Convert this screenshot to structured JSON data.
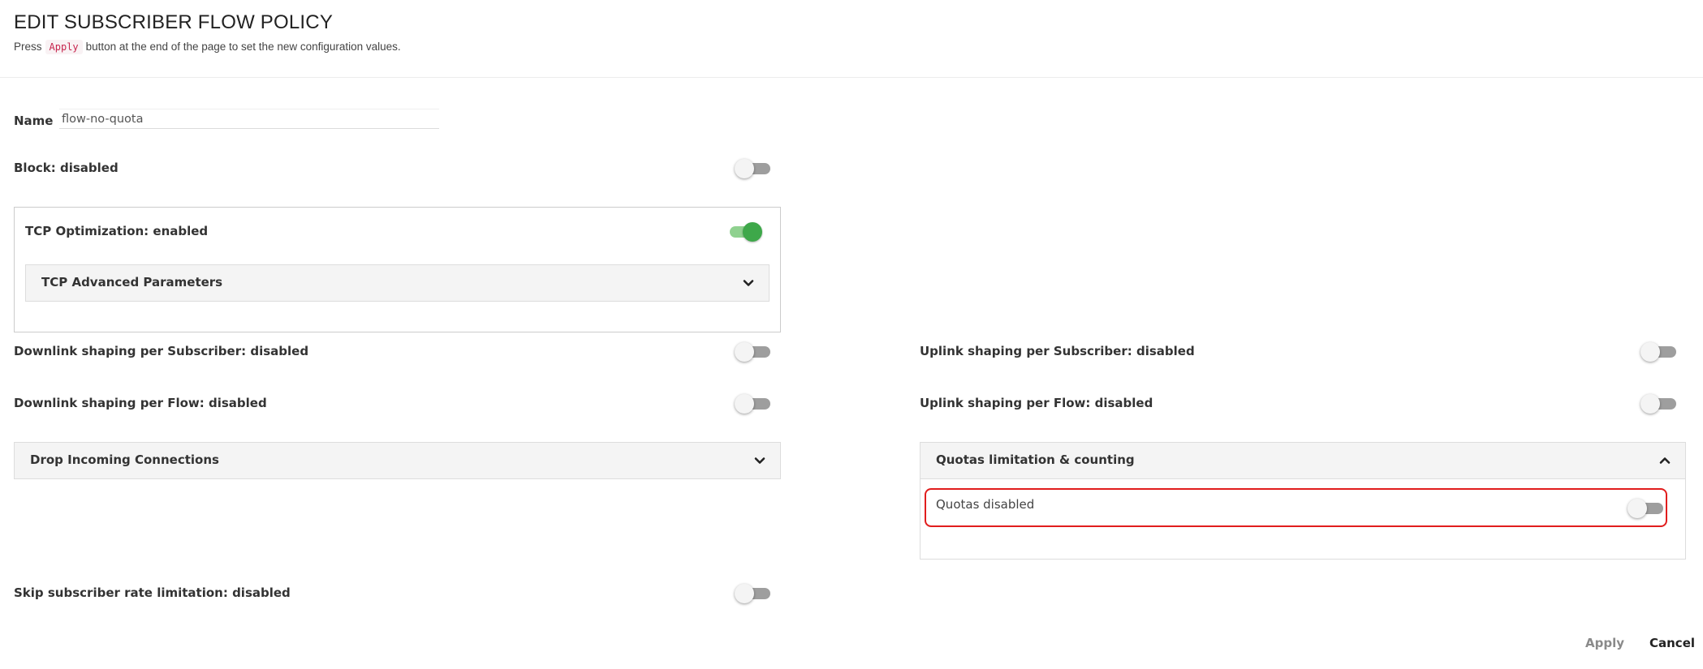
{
  "header": {
    "title": "EDIT SUBSCRIBER FLOW POLICY",
    "subtitle_prefix": "Press",
    "subtitle_code": "Apply",
    "subtitle_suffix": "button at the end of the page to set the new configuration values."
  },
  "form": {
    "name_label": "Name",
    "name_value": "flow-no-quota",
    "block": {
      "label": "Block: disabled",
      "enabled": false
    },
    "tcp_optimization": {
      "label": "TCP Optimization: enabled",
      "enabled": true
    },
    "tcp_advanced": {
      "label": "TCP Advanced Parameters",
      "expanded": false
    },
    "downlink_subscriber": {
      "label": "Downlink shaping per Subscriber: disabled",
      "enabled": false
    },
    "uplink_subscriber": {
      "label": "Uplink shaping per Subscriber: disabled",
      "enabled": false
    },
    "downlink_flow": {
      "label": "Downlink shaping per Flow: disabled",
      "enabled": false
    },
    "uplink_flow": {
      "label": "Uplink shaping per Flow: disabled",
      "enabled": false
    },
    "drop_incoming": {
      "label": "Drop Incoming Connections",
      "expanded": false
    },
    "quotas_panel": {
      "label": "Quotas limitation & counting",
      "expanded": true
    },
    "quotas": {
      "label": "Quotas disabled",
      "enabled": false
    },
    "skip_rate": {
      "label": "Skip subscriber rate limitation: disabled",
      "enabled": false
    }
  },
  "actions": {
    "apply_label": "Apply",
    "cancel_label": "Cancel"
  },
  "colors": {
    "toggle_on": "#3ea84a",
    "toggle_off_track": "#9e9e9e",
    "highlight_border": "#e11d1d",
    "code_text": "#c7254e"
  },
  "icons": {
    "collapsed": "chevron-down-icon",
    "expanded": "chevron-up-icon"
  }
}
